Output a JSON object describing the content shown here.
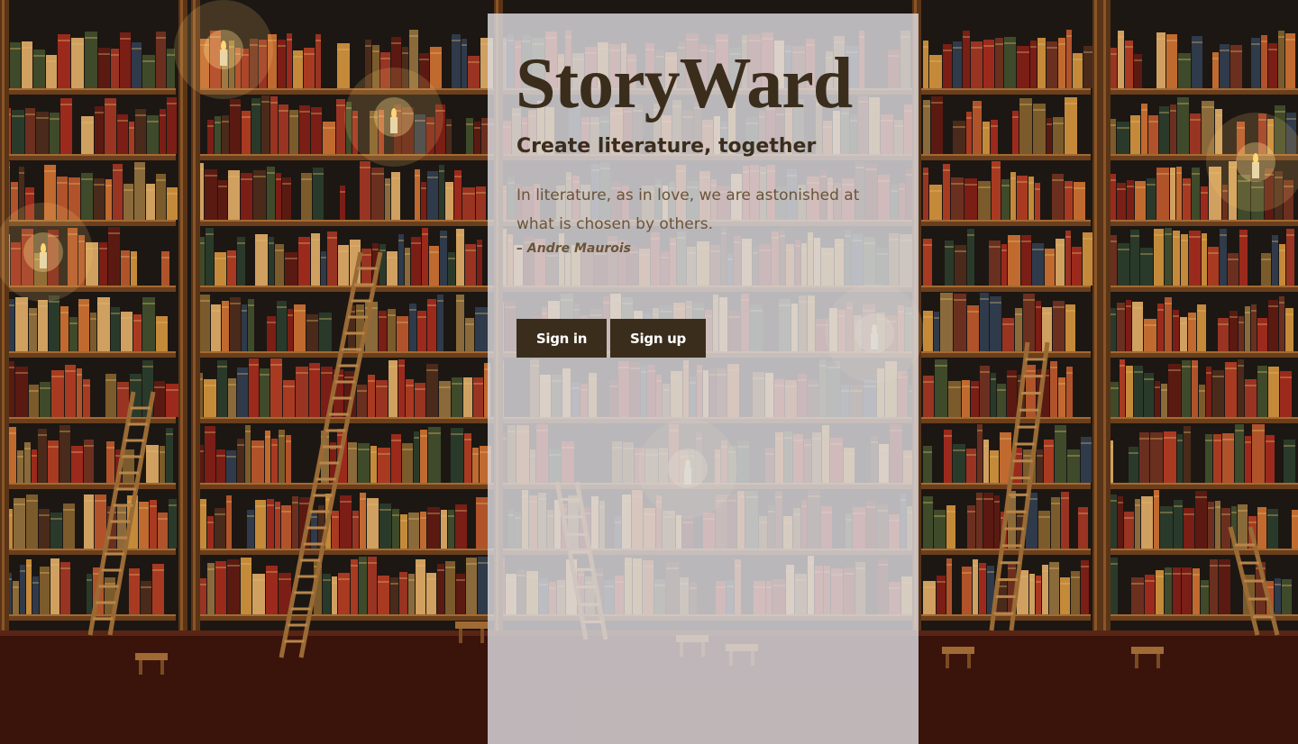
{
  "app": {
    "brand": "StoryWard",
    "tagline": "Create literature, together"
  },
  "quote": {
    "text": "In literature, as in love, we are astonished at what is chosen by others.",
    "author": "– Andre Maurois"
  },
  "actions": {
    "sign_in_label": "Sign in",
    "sign_up_label": "Sign up"
  },
  "colors": {
    "brand_dark": "#3b2d1c",
    "quote_text": "#6a5438",
    "panel_bg": "#dcdade",
    "button_text": "#ffffff"
  }
}
